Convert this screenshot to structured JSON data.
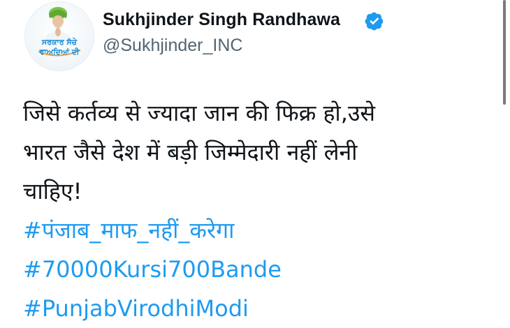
{
  "author": {
    "display_name": "Sukhjinder Singh Randhawa",
    "handle": "@Sukhjinder_INC",
    "verified": true,
    "avatar_text_line1": "ਸਰਕਾਰ ਸੱਚੇ",
    "avatar_text_line2": "ਵਾਅਦਿਆਂ ਦੀ"
  },
  "tweet": {
    "lines": [
      "जिसे कर्तव्य से ज्यादा जान की फिक्र हो,उसे",
      "भारत जैसे देश में बड़ी जिम्मेदारी नहीं लेनी",
      "चाहिए!"
    ],
    "hashtags": [
      "#पंजाब_माफ_नहीं_करेगा",
      "#70000Kursi700Bande",
      "#PunjabVirodhiModi"
    ]
  },
  "colors": {
    "hashtag": "#1d9bf0",
    "verified": "#1d9bf0",
    "text": "#0f1419",
    "secondary": "#536471"
  },
  "icons": {
    "verified": "verified-badge-icon"
  }
}
